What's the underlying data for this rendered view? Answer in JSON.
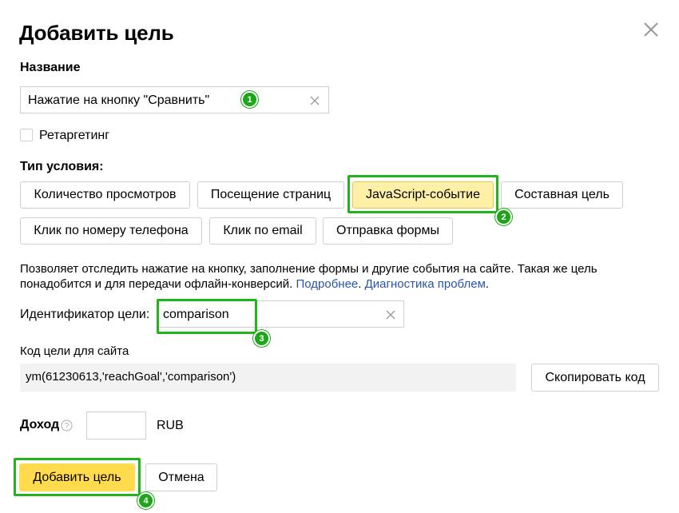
{
  "dialog": {
    "title": "Добавить цель",
    "close_icon": "close-icon"
  },
  "name_section": {
    "label": "Название",
    "value": "Нажатие на кнопку \"Сравнить\"",
    "badge": "1"
  },
  "retargeting": {
    "label": "Ретаргетинг",
    "checked": false
  },
  "condition_type": {
    "label": "Тип условия:",
    "options": [
      {
        "label": "Количество просмотров",
        "selected": false
      },
      {
        "label": "Посещение страниц",
        "selected": false
      },
      {
        "label": "JavaScript-событие",
        "selected": true
      },
      {
        "label": "Составная цель",
        "selected": false
      },
      {
        "label": "Клик по номеру телефона",
        "selected": false
      },
      {
        "label": "Клик по email",
        "selected": false
      },
      {
        "label": "Отправка формы",
        "selected": false
      }
    ],
    "badge": "2"
  },
  "description": {
    "text": "Позволяет отследить нажатие на кнопку, заполнение формы и другие события на сайте. Такая же цель понадобится и для передачи офлайн-конверсий.",
    "link1": "Подробнее",
    "separator": ".",
    "link2": "Диагностика проблем",
    "end": "."
  },
  "goal_id": {
    "label": "Идентификатор цели:",
    "value": "comparison",
    "badge": "3"
  },
  "goal_code": {
    "label": "Код цели для сайта",
    "code": "ym(61230613,'reachGoal','comparison')",
    "copy_button": "Скопировать код"
  },
  "income": {
    "label": "Доход",
    "value": "",
    "currency": "RUB",
    "help_icon": "question-circle-icon"
  },
  "actions": {
    "add_button": "Добавить цель",
    "cancel_button": "Отмена",
    "badge": "4"
  },
  "colors": {
    "highlight": "#22b41b",
    "primary": "#ffdb4d",
    "selected": "#fff0a8",
    "link": "#2a55a5"
  }
}
